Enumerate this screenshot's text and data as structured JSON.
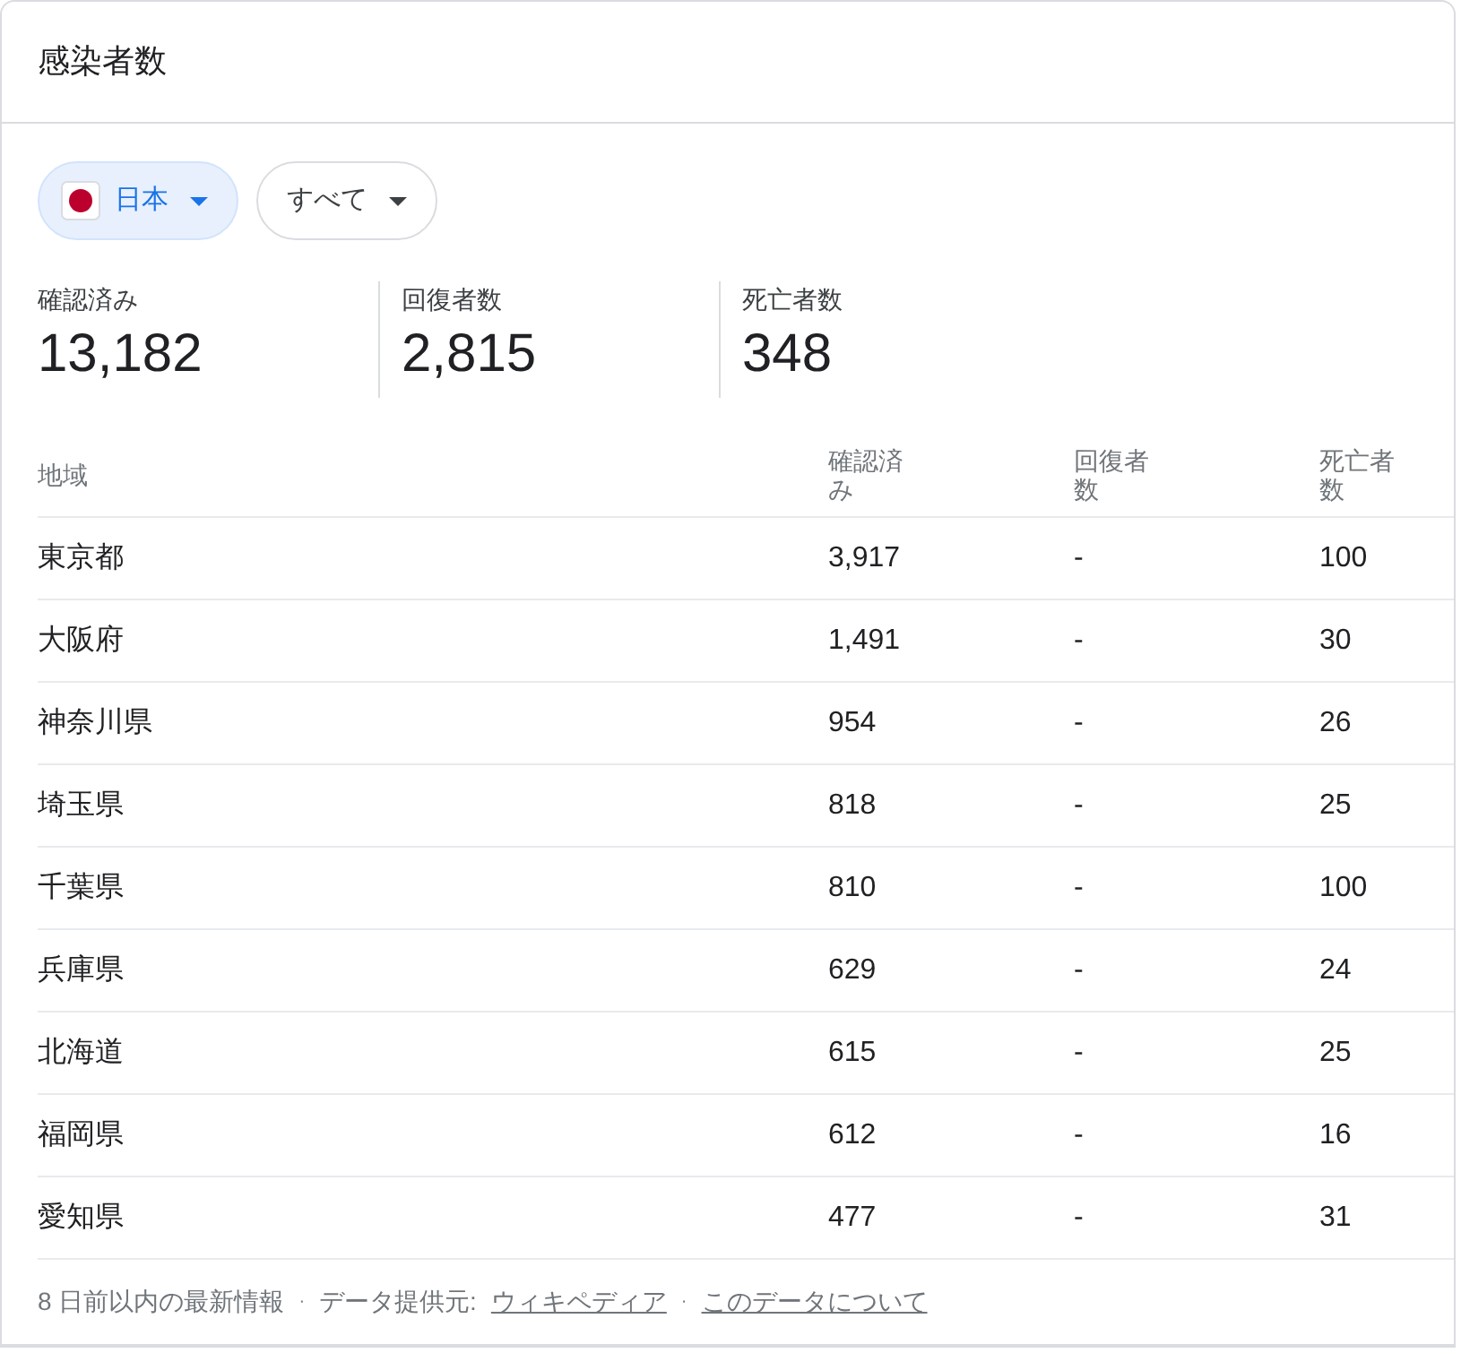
{
  "title": "感染者数",
  "filters": [
    {
      "label": "日本",
      "kind": "country",
      "selected": true
    },
    {
      "label": "すべて",
      "kind": "scope",
      "selected": false
    }
  ],
  "stats": [
    {
      "label": "確認済み",
      "value": "13,182"
    },
    {
      "label": "回復者数",
      "value": "2,815"
    },
    {
      "label": "死亡者数",
      "value": "348"
    }
  ],
  "table": {
    "columns": [
      "地域",
      "確認済み",
      "回復者数",
      "死亡者数"
    ],
    "rows": [
      [
        "東京都",
        "3,917",
        "-",
        "100"
      ],
      [
        "大阪府",
        "1,491",
        "-",
        "30"
      ],
      [
        "神奈川県",
        "954",
        "-",
        "26"
      ],
      [
        "埼玉県",
        "818",
        "-",
        "25"
      ],
      [
        "千葉県",
        "810",
        "-",
        "100"
      ],
      [
        "兵庫県",
        "629",
        "-",
        "24"
      ],
      [
        "北海道",
        "615",
        "-",
        "25"
      ],
      [
        "福岡県",
        "612",
        "-",
        "16"
      ],
      [
        "愛知県",
        "477",
        "-",
        "31"
      ]
    ]
  },
  "footer": {
    "updated": "8 日前以内の最新情報",
    "separator": "·",
    "source_label": "データ提供元:",
    "source_link": "ウィキペディア",
    "about_link": "このデータについて"
  }
}
